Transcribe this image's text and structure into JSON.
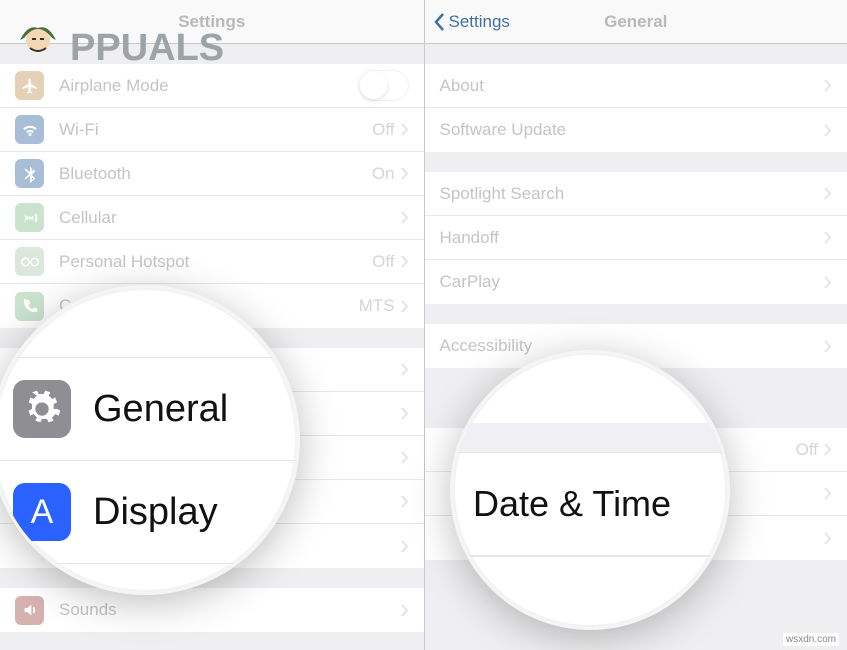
{
  "watermark": {
    "text": "PPUALS"
  },
  "sitecred": "wsxdn.com",
  "left": {
    "nav_title": "Settings",
    "rows": {
      "airplane": {
        "label": "Airplane Mode"
      },
      "wifi": {
        "label": "Wi-Fi",
        "value": "Off"
      },
      "bluetooth": {
        "label": "Bluetooth",
        "value": "On"
      },
      "cellular": {
        "label": "Cellular"
      },
      "hotspot": {
        "label": "Personal Hotspot",
        "value": "Off"
      },
      "carrier": {
        "label": "Carrier",
        "value": "MTS"
      },
      "sounds": {
        "label": "Sounds"
      }
    },
    "lens": {
      "general": "General",
      "display": "Display"
    }
  },
  "right": {
    "nav_back": "Settings",
    "nav_title": "General",
    "rows": {
      "about": {
        "label": "About"
      },
      "swupdate": {
        "label": "Software Update"
      },
      "spotlight": {
        "label": "Spotlight Search"
      },
      "handoff": {
        "label": "Handoff"
      },
      "carplay": {
        "label": "CarPlay"
      },
      "accessibility": {
        "label": "Accessibility"
      },
      "hidden_off": {
        "value": "Off"
      }
    },
    "lens": {
      "datetime": "Date & Time"
    }
  }
}
